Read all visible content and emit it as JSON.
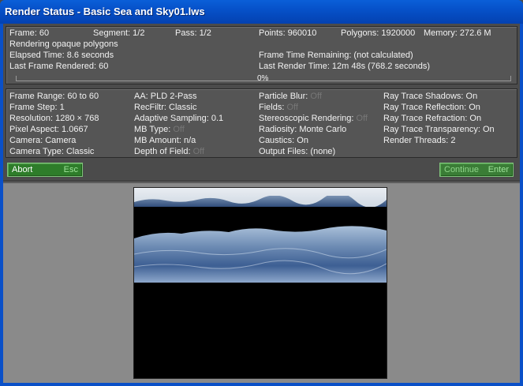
{
  "window": {
    "title": "Render Status - Basic Sea and Sky01.lws"
  },
  "status": {
    "frame": "Frame: 60",
    "segment": "Segment: 1/2",
    "pass": "Pass: 1/2",
    "points": "Points: 960010",
    "polygons": "Polygons: 1920000",
    "memory": "Memory: 272.6 M",
    "activity": "Rendering opaque polygons",
    "elapsed": "Elapsed Time: 8.6 seconds",
    "last_frame": "Last Frame Rendered: 60",
    "frame_time_remaining": "Frame Time Remaining: (not calculated)",
    "last_render_time": "Last Render Time: 12m 48s (768.2 seconds)",
    "progress_label": "0%",
    "progress_value": 0
  },
  "settings": {
    "col1": [
      {
        "text": "Frame Range: 60 to 60"
      },
      {
        "text": "Frame Step: 1"
      },
      {
        "text": "Resolution: 1280 × 768"
      },
      {
        "text": "Pixel Aspect: 1.0667"
      },
      {
        "text": "Camera: Camera"
      },
      {
        "text": "Camera Type: Classic"
      }
    ],
    "col2": [
      {
        "label": "AA: PLD  2-Pass",
        "value": ""
      },
      {
        "label": "RecFiltr: Classic",
        "value": ""
      },
      {
        "label": "Adaptive Sampling: 0.1",
        "value": ""
      },
      {
        "label": "MB Type: ",
        "value": "Off"
      },
      {
        "label": "MB Amount: n/a",
        "value": ""
      },
      {
        "label": "Depth of Field: ",
        "value": "Off"
      }
    ],
    "col3": [
      {
        "label": "Particle Blur: ",
        "value": "Off"
      },
      {
        "label": "Fields: ",
        "value": "Off"
      },
      {
        "label": "Stereoscopic Rendering: ",
        "value": "Off"
      },
      {
        "label": "Radiosity: Monte Carlo",
        "value": ""
      },
      {
        "label": "Caustics: On",
        "value": ""
      },
      {
        "label": "Output Files: (none)",
        "value": ""
      }
    ],
    "col4": [
      {
        "text": "Ray Trace Shadows: On"
      },
      {
        "text": "Ray Trace Reflection: On"
      },
      {
        "text": "Ray Trace Refraction: On"
      },
      {
        "text": "Ray Trace Transparency: On"
      },
      {
        "text": "Render Threads: 2"
      }
    ]
  },
  "buttons": {
    "abort_label": "Abort",
    "abort_key": "Esc",
    "continue_label": "Continue",
    "continue_key": "Enter"
  },
  "colors": {
    "titlebar": "#0651c9",
    "panel": "#555555",
    "button_green": "#2e7d2a",
    "viewer_bg": "#8a8a8a"
  }
}
